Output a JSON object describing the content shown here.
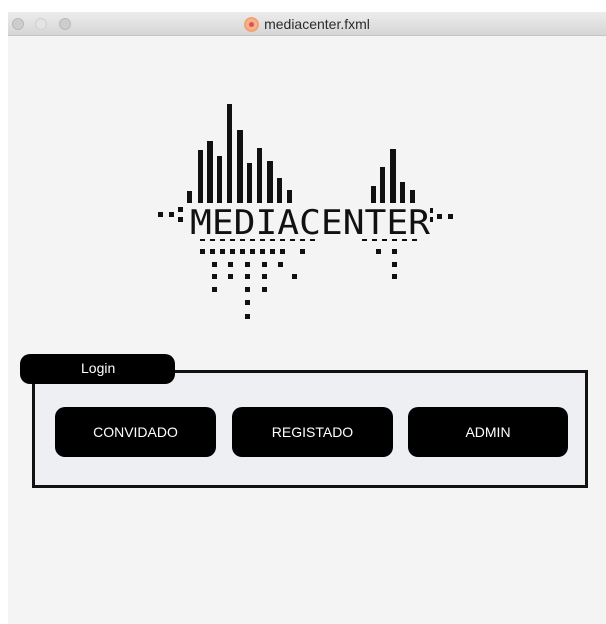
{
  "window": {
    "title": "mediacenter.fxml",
    "app_icon": "fxml-file-icon"
  },
  "logo": {
    "text": "MEDIACENTER",
    "icon": "audio-waveform-logo"
  },
  "login": {
    "legend": "Login",
    "buttons": {
      "guest": "CONVIDADO",
      "registered": "REGISTADO",
      "admin": "ADMIN"
    }
  },
  "colors": {
    "window_bg": "#f4f4f4",
    "panel_bg": "#eeeff2",
    "button_bg": "#000000",
    "button_text": "#ffffff"
  }
}
